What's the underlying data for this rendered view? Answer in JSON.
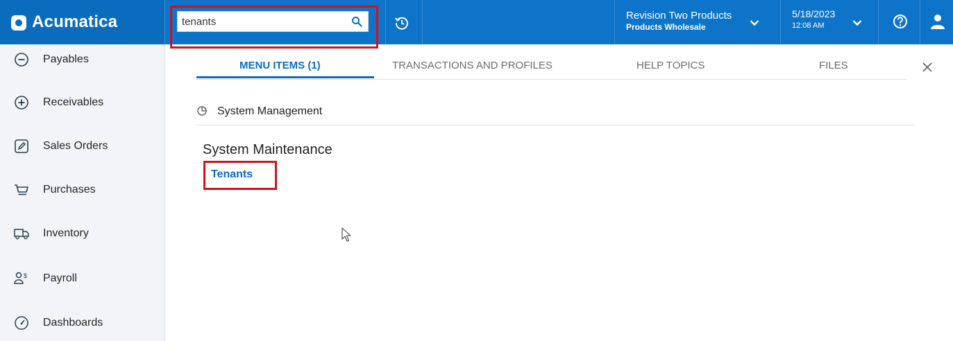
{
  "header": {
    "app_name": "Acumatica",
    "search": {
      "value": "tenants",
      "placeholder": ""
    },
    "company": {
      "name": "Revision Two Products",
      "branch": "Products Wholesale"
    },
    "datetime": {
      "date": "5/18/2023",
      "time": "12:08 AM"
    },
    "icons": [
      "search-icon",
      "history-icon",
      "chevron-down-icon",
      "help-icon",
      "user-icon"
    ]
  },
  "sidebar": {
    "items": [
      {
        "label": "Payables",
        "icon": "minus-circle-icon"
      },
      {
        "label": "Receivables",
        "icon": "plus-circle-icon"
      },
      {
        "label": "Sales Orders",
        "icon": "pencil-square-icon"
      },
      {
        "label": "Purchases",
        "icon": "cart-icon"
      },
      {
        "label": "Inventory",
        "icon": "truck-icon"
      },
      {
        "label": "Payroll",
        "icon": "payroll-icon"
      },
      {
        "label": "Dashboards",
        "icon": "gauge-icon"
      }
    ]
  },
  "search_results": {
    "tabs": [
      {
        "label": "MENU ITEMS  (1)",
        "active": true
      },
      {
        "label": "TRANSACTIONS AND PROFILES",
        "active": false
      },
      {
        "label": "HELP TOPICS",
        "active": false
      },
      {
        "label": "FILES",
        "active": false
      }
    ],
    "section": {
      "label": "System Management"
    },
    "group": {
      "title": "System Maintenance"
    },
    "results": [
      {
        "label": "Tenants"
      }
    ]
  },
  "colors": {
    "header_bg": "#0d74c9",
    "accent": "#0b6cbd",
    "highlight_box": "#d1121b",
    "sidebar_bg": "#f2f4f7"
  }
}
